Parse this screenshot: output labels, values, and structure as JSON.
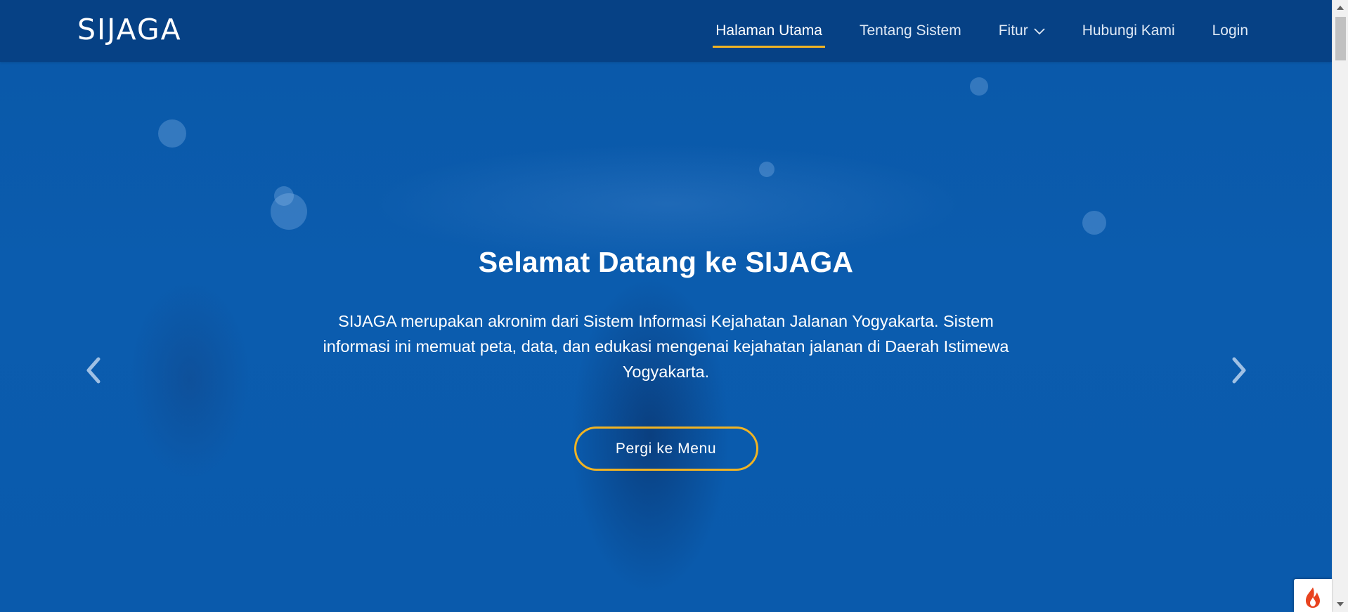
{
  "brand": "SIJAGA",
  "nav": {
    "items": [
      {
        "label": "Halaman Utama",
        "active": true
      },
      {
        "label": "Tentang Sistem",
        "active": false
      },
      {
        "label": "Fitur",
        "active": false,
        "dropdown": true
      },
      {
        "label": "Hubungi Kami",
        "active": false
      },
      {
        "label": "Login",
        "active": false
      }
    ]
  },
  "hero": {
    "title": "Selamat Datang ke SIJAGA",
    "description": "SIJAGA merupakan akronim dari Sistem Informasi Kejahatan Jalanan Yogyakarta. Sistem informasi ini memuat peta, data, dan edukasi mengenai kejahatan jalanan di Daerah Istimewa Yogyakarta.",
    "cta_label": "Pergi ke Menu"
  },
  "icons": {
    "prev": "chevron-left-icon",
    "next": "chevron-right-icon",
    "dropdown": "chevron-down-icon",
    "badge": "flame-icon"
  },
  "colors": {
    "navbar": "#063e80",
    "hero_overlay": "#0a5aaa",
    "accent": "#f0b323",
    "badge_flame": "#e8431f"
  }
}
